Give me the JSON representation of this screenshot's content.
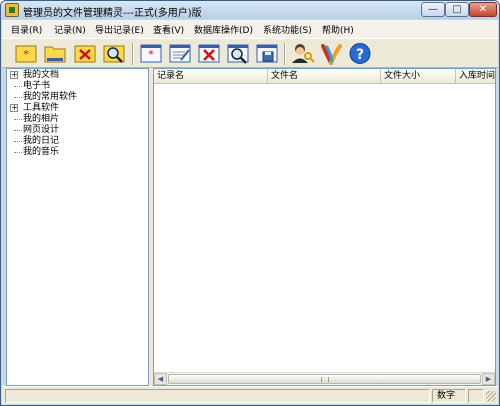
{
  "window": {
    "title": "管理员的文件管理精灵---正式(多用户)版",
    "controls": {
      "minimize": "—",
      "maximize": "□",
      "close": "✕"
    }
  },
  "menu": {
    "items": [
      {
        "label": "目录(R)"
      },
      {
        "label": "记录(N)"
      },
      {
        "label": "导出记录(E)"
      },
      {
        "label": "查看(V)"
      },
      {
        "label": "数据库操作(D)"
      },
      {
        "label": "系统功能(S)"
      },
      {
        "label": "帮助(H)"
      }
    ]
  },
  "toolbar": {
    "buttons": [
      {
        "icon": "new-folder-star-icon"
      },
      {
        "icon": "folder-icon"
      },
      {
        "icon": "delete-folder-icon"
      },
      {
        "icon": "search-folder-icon"
      },
      {
        "icon": "new-record-icon"
      },
      {
        "icon": "edit-record-icon"
      },
      {
        "icon": "delete-record-icon"
      },
      {
        "icon": "search-record-icon"
      },
      {
        "icon": "save-record-icon"
      },
      {
        "icon": "users-key-icon"
      },
      {
        "icon": "app-logo-icon"
      },
      {
        "icon": "help-icon"
      }
    ]
  },
  "tree": {
    "items": [
      {
        "label": "我的文档",
        "expandable": true,
        "expander": "+"
      },
      {
        "label": "电子书",
        "expandable": false
      },
      {
        "label": "我的常用软件",
        "expandable": false
      },
      {
        "label": "工具软件",
        "expandable": true,
        "expander": "+"
      },
      {
        "label": "我的相片",
        "expandable": false
      },
      {
        "label": "网页设计",
        "expandable": false
      },
      {
        "label": "我的日记",
        "expandable": false
      },
      {
        "label": "我的音乐",
        "expandable": false
      }
    ]
  },
  "list": {
    "columns": [
      {
        "label": "记录名"
      },
      {
        "label": "文件名"
      },
      {
        "label": "文件大小"
      },
      {
        "label": "入库时间"
      }
    ],
    "rows": []
  },
  "scrollbar": {
    "left_arrow": "◀",
    "right_arrow": "▶"
  },
  "status": {
    "panes": [
      "",
      "",
      "数字",
      ""
    ]
  },
  "colors": {
    "accent": "#3f5f80",
    "window_bg": "#ece9d8",
    "close_red": "#c2452f"
  }
}
